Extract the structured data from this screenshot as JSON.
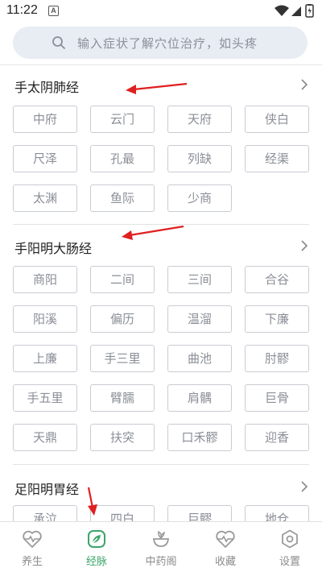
{
  "status_bar": {
    "time": "11:22",
    "a_badge": "A"
  },
  "search": {
    "placeholder": "输入症状了解穴位治疗，如头疼"
  },
  "sections": [
    {
      "title": "手太阴肺经",
      "points": [
        "中府",
        "云门",
        "天府",
        "侠白",
        "尺泽",
        "孔最",
        "列缺",
        "经渠",
        "太渊",
        "鱼际",
        "少商"
      ]
    },
    {
      "title": "手阳明大肠经",
      "points": [
        "商阳",
        "二间",
        "三间",
        "合谷",
        "阳溪",
        "偏历",
        "温溜",
        "下廉",
        "上廉",
        "手三里",
        "曲池",
        "肘髎",
        "手五里",
        "臂臑",
        "肩髃",
        "巨骨",
        "天鼎",
        "扶突",
        "口禾髎",
        "迎香"
      ]
    },
    {
      "title": "足阳明胃经",
      "points": [
        "承泣",
        "四白",
        "巨髎",
        "地仓"
      ]
    }
  ],
  "bottom_nav": [
    {
      "label": "养生",
      "icon": "heart-pulse-icon",
      "active": false
    },
    {
      "label": "经脉",
      "icon": "leaf-icon",
      "active": true
    },
    {
      "label": "中药阁",
      "icon": "herb-bowl-icon",
      "active": false
    },
    {
      "label": "收藏",
      "icon": "heart-pulse-icon",
      "active": false
    },
    {
      "label": "设置",
      "icon": "gear-icon",
      "active": false
    }
  ],
  "colors": {
    "accent": "#3aa569",
    "search_bg": "#e8ecf3",
    "annotation_arrow": "#e02020"
  }
}
